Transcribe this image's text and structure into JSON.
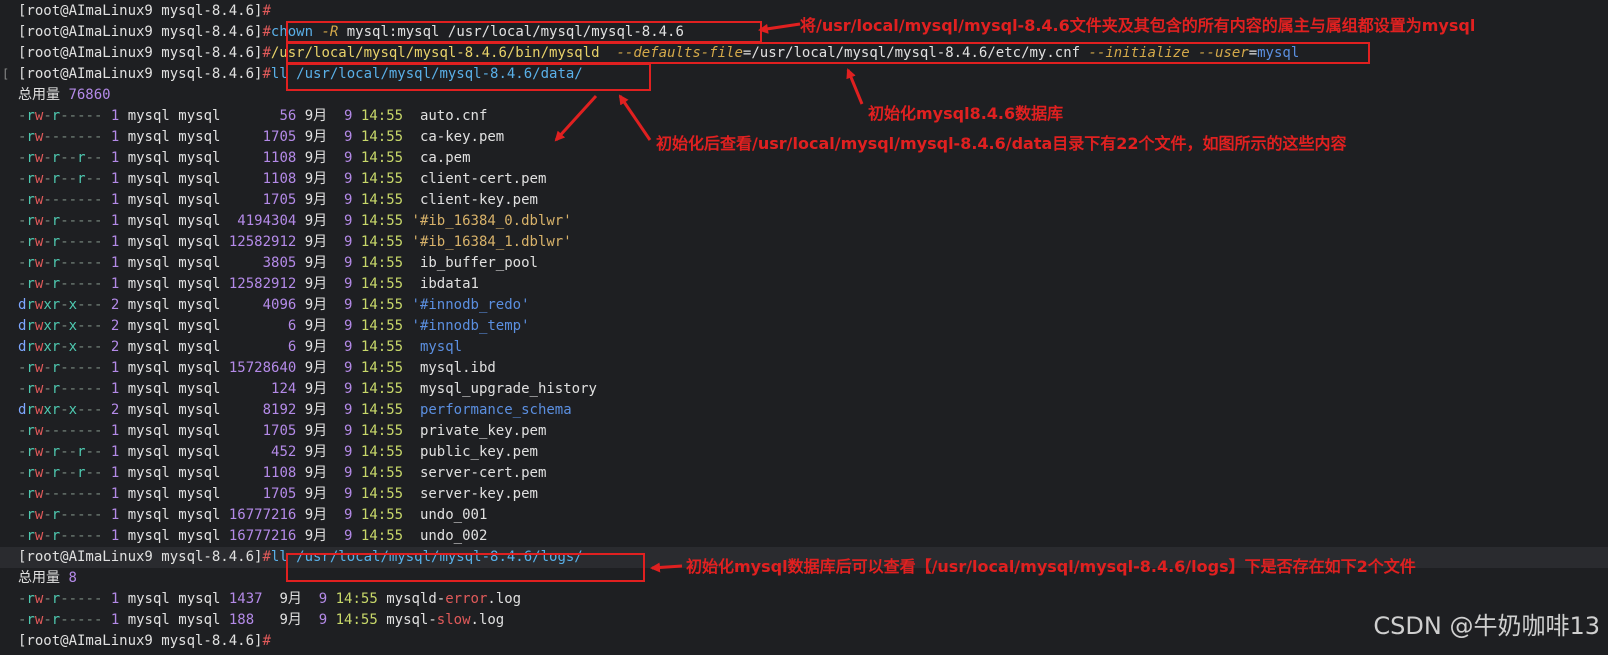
{
  "prompt": "[root@AImaLinux9 mysql-8.4.6]",
  "hash": "#",
  "commands": {
    "chown": {
      "cmd": "chown",
      "opt": "-R",
      "rest": " mysql:mysql /usr/local/mysql/mysql-8.4.6"
    },
    "init": {
      "bin": "/usr/local/mysql/mysql-8.4.6/bin/mysqld",
      "opt1": "--defaults-file",
      "eq": "=",
      "path": "/usr/local/mysql/mysql-8.4.6/etc/my.cnf",
      "opt2": "--initialize",
      "opt3": "--user",
      "eq2": "=",
      "user": "mysql"
    },
    "ll_data": "ll /usr/local/mysql/mysql-8.4.6/data/",
    "ll_logs": "ll /usr/local/mysql/mysql-8.4.6/logs/"
  },
  "data_listing": {
    "summary_label": "总用量",
    "summary_value": "76860",
    "rows": [
      {
        "perm": "-rw-r-----",
        "links": "1",
        "user": "mysql",
        "group": "mysql",
        "size": "56",
        "month": "9月",
        "day": "9",
        "time": "14:55",
        "name": "auto.cnf",
        "kind": "file"
      },
      {
        "perm": "-rw-------",
        "links": "1",
        "user": "mysql",
        "group": "mysql",
        "size": "1705",
        "month": "9月",
        "day": "9",
        "time": "14:55",
        "name": "ca-key.pem",
        "kind": "file"
      },
      {
        "perm": "-rw-r--r--",
        "links": "1",
        "user": "mysql",
        "group": "mysql",
        "size": "1108",
        "month": "9月",
        "day": "9",
        "time": "14:55",
        "name": "ca.pem",
        "kind": "file"
      },
      {
        "perm": "-rw-r--r--",
        "links": "1",
        "user": "mysql",
        "group": "mysql",
        "size": "1108",
        "month": "9月",
        "day": "9",
        "time": "14:55",
        "name": "client-cert.pem",
        "kind": "file"
      },
      {
        "perm": "-rw-------",
        "links": "1",
        "user": "mysql",
        "group": "mysql",
        "size": "1705",
        "month": "9月",
        "day": "9",
        "time": "14:55",
        "name": "client-key.pem",
        "kind": "file"
      },
      {
        "perm": "-rw-r-----",
        "links": "1",
        "user": "mysql",
        "group": "mysql",
        "size": "4194304",
        "month": "9月",
        "day": "9",
        "time": "14:55",
        "name": "'#ib_16384_0.dblwr'",
        "kind": "quoted"
      },
      {
        "perm": "-rw-r-----",
        "links": "1",
        "user": "mysql",
        "group": "mysql",
        "size": "12582912",
        "month": "9月",
        "day": "9",
        "time": "14:55",
        "name": "'#ib_16384_1.dblwr'",
        "kind": "quoted"
      },
      {
        "perm": "-rw-r-----",
        "links": "1",
        "user": "mysql",
        "group": "mysql",
        "size": "3805",
        "month": "9月",
        "day": "9",
        "time": "14:55",
        "name": "ib_buffer_pool",
        "kind": "file"
      },
      {
        "perm": "-rw-r-----",
        "links": "1",
        "user": "mysql",
        "group": "mysql",
        "size": "12582912",
        "month": "9月",
        "day": "9",
        "time": "14:55",
        "name": "ibdata1",
        "kind": "file"
      },
      {
        "perm": "drwxr-x---",
        "links": "2",
        "user": "mysql",
        "group": "mysql",
        "size": "4096",
        "month": "9月",
        "day": "9",
        "time": "14:55",
        "name": "'#innodb_redo'",
        "kind": "dirquoted"
      },
      {
        "perm": "drwxr-x---",
        "links": "2",
        "user": "mysql",
        "group": "mysql",
        "size": "6",
        "month": "9月",
        "day": "9",
        "time": "14:55",
        "name": "'#innodb_temp'",
        "kind": "dirquoted"
      },
      {
        "perm": "drwxr-x---",
        "links": "2",
        "user": "mysql",
        "group": "mysql",
        "size": "6",
        "month": "9月",
        "day": "9",
        "time": "14:55",
        "name": "mysql",
        "kind": "dir"
      },
      {
        "perm": "-rw-r-----",
        "links": "1",
        "user": "mysql",
        "group": "mysql",
        "size": "15728640",
        "month": "9月",
        "day": "9",
        "time": "14:55",
        "name": "mysql.ibd",
        "kind": "file"
      },
      {
        "perm": "-rw-r-----",
        "links": "1",
        "user": "mysql",
        "group": "mysql",
        "size": "124",
        "month": "9月",
        "day": "9",
        "time": "14:55",
        "name": "mysql_upgrade_history",
        "kind": "file"
      },
      {
        "perm": "drwxr-x---",
        "links": "2",
        "user": "mysql",
        "group": "mysql",
        "size": "8192",
        "month": "9月",
        "day": "9",
        "time": "14:55",
        "name": "performance_schema",
        "kind": "dir"
      },
      {
        "perm": "-rw-------",
        "links": "1",
        "user": "mysql",
        "group": "mysql",
        "size": "1705",
        "month": "9月",
        "day": "9",
        "time": "14:55",
        "name": "private_key.pem",
        "kind": "file"
      },
      {
        "perm": "-rw-r--r--",
        "links": "1",
        "user": "mysql",
        "group": "mysql",
        "size": "452",
        "month": "9月",
        "day": "9",
        "time": "14:55",
        "name": "public_key.pem",
        "kind": "file"
      },
      {
        "perm": "-rw-r--r--",
        "links": "1",
        "user": "mysql",
        "group": "mysql",
        "size": "1108",
        "month": "9月",
        "day": "9",
        "time": "14:55",
        "name": "server-cert.pem",
        "kind": "file"
      },
      {
        "perm": "-rw-------",
        "links": "1",
        "user": "mysql",
        "group": "mysql",
        "size": "1705",
        "month": "9月",
        "day": "9",
        "time": "14:55",
        "name": "server-key.pem",
        "kind": "file"
      },
      {
        "perm": "-rw-r-----",
        "links": "1",
        "user": "mysql",
        "group": "mysql",
        "size": "16777216",
        "month": "9月",
        "day": "9",
        "time": "14:55",
        "name": "undo_001",
        "kind": "file"
      },
      {
        "perm": "-rw-r-----",
        "links": "1",
        "user": "mysql",
        "group": "mysql",
        "size": "16777216",
        "month": "9月",
        "day": "9",
        "time": "14:55",
        "name": "undo_002",
        "kind": "file"
      }
    ]
  },
  "logs_listing": {
    "summary_label": "总用量",
    "summary_value": "8",
    "rows": [
      {
        "perm": "-rw-r-----",
        "links": "1",
        "user": "mysql",
        "group": "mysql",
        "size": "1437",
        "month": "9月",
        "day": "9",
        "time": "14:55",
        "name": "mysqld-error.log"
      },
      {
        "perm": "-rw-r-----",
        "links": "1",
        "user": "mysql",
        "group": "mysql",
        "size": "188",
        "month": "9月",
        "day": "9",
        "time": "14:55",
        "name": "mysql-slow.log"
      }
    ]
  },
  "annotations": {
    "chown_note": "将/usr/local/mysql/mysql-8.4.6文件夹及其包含的所有内容的属主与属组都设置为mysql",
    "init_note": "初始化mysql8.4.6数据库",
    "data_note": "初始化后查看/usr/local/mysql/mysql-8.4.6/data目录下有22个文件，如图所示的这些内容",
    "logs_note": "初始化mysql数据库后可以查看【/usr/local/mysql/mysql-8.4.6/logs】下是否存在如下2个文件"
  },
  "watermark": "CSDN @牛奶咖啡13",
  "colors": {
    "annotation": "#e02020",
    "background": "#1e1f22"
  }
}
